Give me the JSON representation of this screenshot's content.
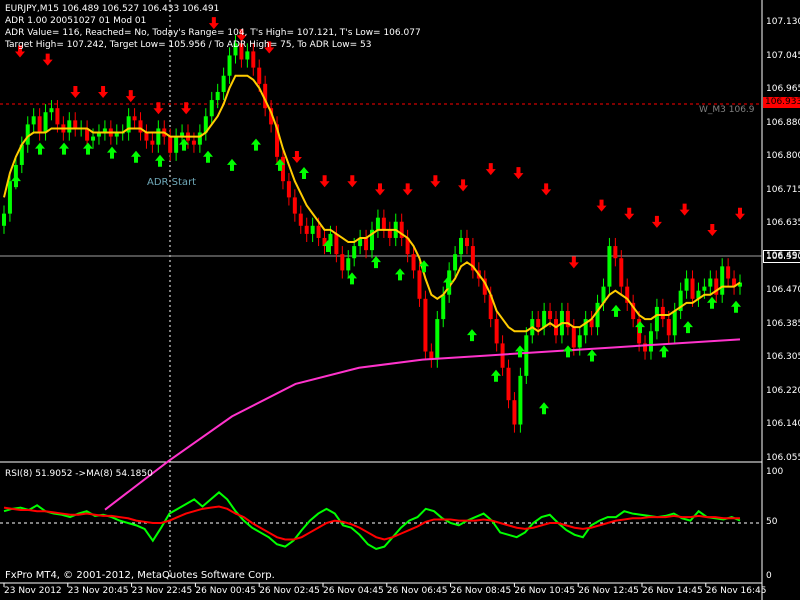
{
  "header": {
    "symbol_line": "EURJPY,M15  106.489 106.527 106.433 106.491",
    "adr_line": "ADR 1.00 20051027 01 Mod 01",
    "adr_value_line": "ADR Value= 116, Reached= No, Today's Range= 104, T's High= 107.121, T's Low= 106.077",
    "target_line": "Target High= 107.242, Target Low= 105.956 / To ADR High= 75, To ADR Low= 53"
  },
  "annotations": {
    "adr_start": "ADR Start",
    "wm3_label": "W_M3 106.9",
    "wm3_price_tag": "106.933",
    "current_price_tag": "106.491"
  },
  "rsi_panel": {
    "label": "RSI(8) 51.9052  ->MA(8) 54.1850",
    "level_50": "50",
    "axis_max": "100",
    "axis_min": "0"
  },
  "footer": {
    "copyright": "FxPro MT4, © 2001-2012, MetaQuotes Software Corp."
  },
  "colors": {
    "background": "#000000",
    "bull_candle": "#00ff00",
    "bear_candle": "#ff0000",
    "ma_fast": "#ffcc00",
    "ma_slow": "#ff33cc",
    "rsi_line": "#00ff00",
    "rsi_ma": "#ff0000",
    "wm3_line": "#ff0000",
    "up_arrow": "#00ff00",
    "down_arrow": "#ff0000"
  },
  "chart_data": [
    {
      "type": "candlestick",
      "title": "EURJPY,M15",
      "y_ticks": [
        "107.130",
        "107.045",
        "106.965",
        "106.880",
        "106.800",
        "106.715",
        "106.635",
        "106.550",
        "106.470",
        "106.385",
        "106.305",
        "106.220",
        "106.140",
        "106.055"
      ],
      "x_ticks": [
        "23 Nov 2012",
        "23 Nov 20:45",
        "23 Nov 22:45",
        "26 Nov 00:45",
        "26 Nov 02:45",
        "26 Nov 04:45",
        "26 Nov 06:45",
        "26 Nov 08:45",
        "26 Nov 10:45",
        "26 Nov 12:45",
        "26 Nov 14:45",
        "26 Nov 16:45"
      ],
      "ylim": [
        106.05,
        107.155
      ],
      "horizontal_lines": [
        {
          "name": "W_M3",
          "value": 106.933
        },
        {
          "name": "current",
          "value": 106.491
        }
      ],
      "close_series": [
        106.66,
        106.74,
        106.78,
        106.83,
        106.88,
        106.9,
        106.86,
        106.91,
        106.92,
        106.88,
        106.86,
        106.89,
        106.87,
        106.87,
        106.84,
        106.85,
        106.86,
        106.87,
        106.85,
        106.86,
        106.86,
        106.9,
        106.89,
        106.86,
        106.84,
        106.83,
        106.87,
        106.85,
        106.81,
        106.85,
        106.86,
        106.84,
        106.83,
        106.86,
        106.9,
        106.94,
        106.96,
        107.0,
        107.05,
        107.08,
        107.04,
        107.06,
        107.02,
        106.98,
        106.92,
        106.88,
        106.8,
        106.74,
        106.7,
        106.66,
        106.63,
        106.61,
        106.63,
        106.6,
        106.58,
        106.61,
        106.56,
        106.52,
        106.55,
        106.58,
        106.6,
        106.57,
        106.62,
        106.65,
        106.62,
        106.6,
        106.64,
        106.6,
        106.56,
        106.52,
        106.45,
        106.32,
        106.3,
        106.4,
        106.46,
        106.52,
        106.56,
        106.6,
        106.58,
        106.52,
        106.5,
        106.46,
        106.4,
        106.34,
        106.28,
        106.2,
        106.14,
        106.26,
        106.36,
        106.4,
        106.38,
        106.42,
        106.4,
        106.36,
        106.42,
        106.38,
        106.33,
        106.36,
        106.4,
        106.38,
        106.44,
        106.48,
        106.58,
        106.55,
        106.48,
        106.44,
        106.4,
        106.34,
        106.32,
        106.37,
        106.43,
        106.4,
        106.36,
        106.42,
        106.47,
        106.5,
        106.45,
        106.47,
        106.48,
        106.5,
        106.46,
        106.53,
        106.5,
        106.48,
        106.49
      ],
      "ma_fast_series": [
        106.7,
        106.76,
        106.8,
        106.83,
        106.85,
        106.86,
        106.86,
        106.86,
        106.87,
        106.87,
        106.87,
        106.87,
        106.87,
        106.87,
        106.87,
        106.86,
        106.86,
        106.86,
        106.86,
        106.86,
        106.86,
        106.87,
        106.87,
        106.87,
        106.86,
        106.86,
        106.86,
        106.86,
        106.85,
        106.85,
        106.85,
        106.85,
        106.85,
        106.85,
        106.86,
        106.88,
        106.9,
        106.93,
        106.97,
        107.0,
        107.0,
        107.0,
        106.99,
        106.97,
        106.94,
        106.91,
        106.87,
        106.82,
        106.78,
        106.74,
        106.71,
        106.68,
        106.66,
        106.64,
        106.62,
        106.62,
        106.61,
        106.6,
        106.59,
        106.59,
        106.6,
        106.6,
        106.61,
        106.62,
        106.62,
        106.62,
        106.62,
        106.61,
        106.6,
        106.58,
        106.55,
        106.5,
        106.46,
        106.45,
        106.46,
        106.48,
        106.5,
        106.53,
        106.54,
        106.53,
        106.51,
        106.49,
        106.46,
        106.42,
        106.4,
        106.38,
        106.37,
        106.37,
        106.37,
        106.38,
        106.37,
        106.38,
        106.39,
        106.38,
        106.39,
        106.39,
        106.38,
        106.38,
        106.39,
        106.4,
        106.42,
        106.44,
        106.46,
        106.47,
        106.46,
        106.45,
        106.43,
        106.41,
        106.4,
        106.4,
        106.41,
        106.41,
        106.41,
        106.42,
        106.43,
        106.44,
        106.44,
        106.45,
        106.46,
        106.46,
        106.47,
        106.48,
        106.48,
        106.48,
        106.49
      ],
      "ma_slow_series": [
        105.93,
        106.05,
        106.16,
        106.24,
        106.28,
        106.3,
        106.31,
        106.32,
        106.33,
        106.34,
        106.35
      ],
      "down_arrow_values": [
        107.04,
        107.02,
        106.94,
        106.94,
        106.93,
        106.9,
        106.9,
        107.11,
        107.08,
        107.05,
        106.78,
        106.72,
        106.72,
        106.7,
        106.7,
        106.72,
        106.71,
        106.75,
        106.74,
        106.7,
        106.52,
        106.66,
        106.64,
        106.62,
        106.65,
        106.6,
        106.64
      ],
      "up_arrow_values": [
        106.76,
        106.84,
        106.84,
        106.84,
        106.83,
        106.82,
        106.81,
        106.85,
        106.82,
        106.8,
        106.85,
        106.8,
        106.78,
        106.6,
        106.52,
        106.56,
        106.53,
        106.55,
        106.51,
        106.38,
        106.28,
        106.34,
        106.2,
        106.34,
        106.33,
        106.44,
        106.4,
        106.34,
        106.4,
        106.46,
        106.45
      ]
    },
    {
      "type": "line",
      "title": "RSI(8) 51.9052  ->MA(8) 54.1850",
      "ylim": [
        0,
        100
      ],
      "levels": [
        50
      ],
      "series": [
        {
          "name": "RSI(8)",
          "values": [
            60,
            62,
            63,
            61,
            65,
            60,
            58,
            57,
            55,
            58,
            60,
            56,
            57,
            55,
            52,
            50,
            48,
            45,
            35,
            46,
            58,
            62,
            66,
            70,
            64,
            70,
            76,
            70,
            60,
            52,
            46,
            42,
            38,
            32,
            30,
            35,
            44,
            52,
            58,
            62,
            58,
            48,
            46,
            40,
            32,
            28,
            30,
            38,
            46,
            52,
            55,
            62,
            60,
            54,
            50,
            48,
            52,
            55,
            58,
            52,
            42,
            40,
            38,
            42,
            50,
            55,
            57,
            50,
            44,
            40,
            38,
            48,
            52,
            55,
            55,
            60,
            58,
            57,
            56,
            55,
            56,
            58,
            54,
            52,
            60,
            55,
            54,
            53,
            55,
            52
          ]
        },
        {
          "name": "MA(8)",
          "values": [
            63,
            62,
            61,
            61,
            60,
            60,
            59,
            58,
            57,
            57,
            58,
            57,
            56,
            56,
            55,
            54,
            52,
            51,
            50,
            50,
            52,
            55,
            58,
            60,
            62,
            63,
            64,
            62,
            58,
            55,
            50,
            46,
            42,
            38,
            36,
            36,
            38,
            42,
            46,
            50,
            52,
            51,
            49,
            46,
            42,
            38,
            36,
            38,
            41,
            44,
            47,
            51,
            53,
            53,
            53,
            52,
            52,
            52,
            53,
            52,
            50,
            48,
            46,
            45,
            46,
            48,
            50,
            50,
            48,
            46,
            45,
            46,
            48,
            50,
            52,
            53,
            54,
            54,
            55,
            55,
            55,
            56,
            55,
            55,
            56,
            55,
            55,
            54,
            54,
            54
          ]
        }
      ]
    }
  ]
}
